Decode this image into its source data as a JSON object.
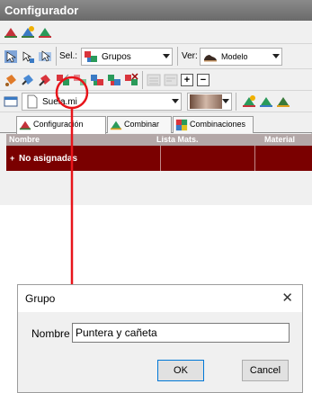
{
  "panel": {
    "title": "Configurador",
    "toolbar2": {
      "sel_label": "Sel.:",
      "sel_value": "Grupos",
      "ver_label": "Ver:",
      "ver_value": "Modelo"
    },
    "toolbar4": {
      "file_value": "Suela.mi"
    },
    "tabs": [
      {
        "label": "Configuración",
        "icon": "hat-icon"
      },
      {
        "label": "Combinar",
        "icon": "combine-icon"
      },
      {
        "label": "Combinaciones",
        "icon": "color-grid-icon"
      }
    ],
    "grid": {
      "columns": [
        "Nombre",
        "Lista Mats.",
        "Material"
      ],
      "rows": [
        {
          "expander": "+",
          "nombre": "No asignadas",
          "lista": "",
          "material": ""
        }
      ]
    }
  },
  "annotation": {
    "color": "#e8141a"
  },
  "dialog": {
    "title": "Grupo",
    "close": "✕",
    "name_label": "Nombre",
    "name_value": "Puntera y cañeta",
    "ok_label": "OK",
    "cancel_label": "Cancel"
  },
  "colors": {
    "titlebar": "#7a7a7a",
    "row_selected": "#7a0000",
    "grid_header": "#b3a7a7"
  }
}
